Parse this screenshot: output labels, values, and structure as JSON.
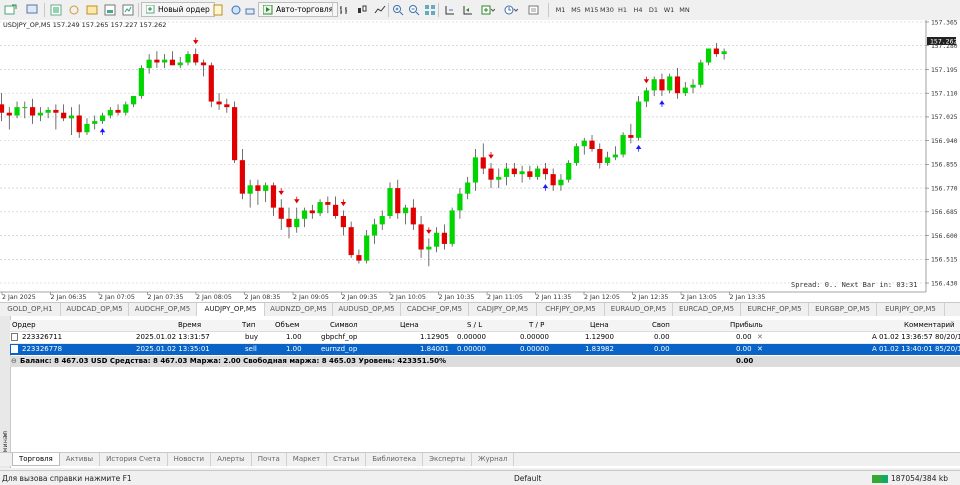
{
  "toolbar": {
    "new_order": "Новый ордер",
    "autotrading": "Авто-торговля",
    "timeframes": [
      "M1",
      "M5",
      "M15",
      "M30",
      "H1",
      "H4",
      "D1",
      "W1",
      "MN"
    ]
  },
  "chart": {
    "header": "USDJPY_OP,M5  157.249 157.265 157.227 157.262",
    "current_price": "157.262",
    "price_labels": [
      "157.365",
      "157.280",
      "157.195",
      "157.110",
      "157.025",
      "156.940",
      "156.855",
      "156.770",
      "156.685",
      "156.600",
      "156.515",
      "156.430"
    ],
    "time_labels": [
      "2 Jan 2025",
      "2 Jan 06:35",
      "2 Jan 07:05",
      "2 Jan 07:35",
      "2 Jan 08:05",
      "2 Jan 08:35",
      "2 Jan 09:05",
      "2 Jan 09:35",
      "2 Jan 10:05",
      "2 Jan 10:35",
      "2 Jan 11:05",
      "2 Jan 11:35",
      "2 Jan 12:05",
      "2 Jan 12:35",
      "2 Jan 13:05",
      "2 Jan 13:35"
    ],
    "spread_text": "Spread: 0.. Next Bar in: 03:31",
    "colors": {
      "bull": "#00d500",
      "bear": "#e00000",
      "arrow_up": "#1a1aff",
      "arrow_down": "#e00000",
      "grid": "#c8c8c8"
    }
  },
  "chart_data": {
    "type": "candlestick",
    "ylim": [
      156.43,
      157.365
    ],
    "candles": [
      [
        157.07,
        157.11,
        157.01,
        157.04
      ],
      [
        157.04,
        157.06,
        156.98,
        157.03
      ],
      [
        157.03,
        157.08,
        157.02,
        157.06
      ],
      [
        157.06,
        157.08,
        157.02,
        157.06
      ],
      [
        157.06,
        157.09,
        157.0,
        157.03
      ],
      [
        157.03,
        157.06,
        157.01,
        157.04
      ],
      [
        157.04,
        157.06,
        157.02,
        157.05
      ],
      [
        157.05,
        157.07,
        156.98,
        157.04
      ],
      [
        157.04,
        157.07,
        157.01,
        157.02
      ],
      [
        157.02,
        157.06,
        156.96,
        157.03
      ],
      [
        157.03,
        157.07,
        156.95,
        156.97
      ],
      [
        156.97,
        157.02,
        156.96,
        157.0
      ],
      [
        157.0,
        157.03,
        156.98,
        157.01
      ],
      [
        157.01,
        157.04,
        157.0,
        157.03
      ],
      [
        157.03,
        157.06,
        157.02,
        157.05
      ],
      [
        157.05,
        157.07,
        157.03,
        157.04
      ],
      [
        157.04,
        157.08,
        157.03,
        157.07
      ],
      [
        157.07,
        157.1,
        157.06,
        157.1
      ],
      [
        157.1,
        157.21,
        157.09,
        157.2
      ],
      [
        157.2,
        157.25,
        157.18,
        157.23
      ],
      [
        157.23,
        157.26,
        157.2,
        157.22
      ],
      [
        157.22,
        157.25,
        157.2,
        157.23
      ],
      [
        157.23,
        157.26,
        157.21,
        157.21
      ],
      [
        157.21,
        157.24,
        157.2,
        157.22
      ],
      [
        157.22,
        157.26,
        157.21,
        157.25
      ],
      [
        157.25,
        157.27,
        157.21,
        157.22
      ],
      [
        157.22,
        157.23,
        157.17,
        157.21
      ],
      [
        157.21,
        157.22,
        157.06,
        157.08
      ],
      [
        157.08,
        157.11,
        157.05,
        157.07
      ],
      [
        157.07,
        157.09,
        157.04,
        157.06
      ],
      [
        157.06,
        157.08,
        156.86,
        156.87
      ],
      [
        156.87,
        156.91,
        156.73,
        156.75
      ],
      [
        156.75,
        156.8,
        156.7,
        156.78
      ],
      [
        156.78,
        156.8,
        156.71,
        156.76
      ],
      [
        156.76,
        156.79,
        156.72,
        156.78
      ],
      [
        156.78,
        156.79,
        156.67,
        156.7
      ],
      [
        156.7,
        156.73,
        156.62,
        156.66
      ],
      [
        156.66,
        156.7,
        156.59,
        156.63
      ],
      [
        156.63,
        156.7,
        156.61,
        156.66
      ],
      [
        156.66,
        156.7,
        156.63,
        156.69
      ],
      [
        156.69,
        156.71,
        156.66,
        156.68
      ],
      [
        156.68,
        156.73,
        156.67,
        156.72
      ],
      [
        156.72,
        156.74,
        156.68,
        156.71
      ],
      [
        156.71,
        156.74,
        156.66,
        156.67
      ],
      [
        156.67,
        156.69,
        156.6,
        156.63
      ],
      [
        156.63,
        156.65,
        156.52,
        156.53
      ],
      [
        156.53,
        156.55,
        156.5,
        156.51
      ],
      [
        156.51,
        156.62,
        156.5,
        156.6
      ],
      [
        156.6,
        156.66,
        156.57,
        156.64
      ],
      [
        156.64,
        156.69,
        156.62,
        156.67
      ],
      [
        156.67,
        156.79,
        156.66,
        156.77
      ],
      [
        156.77,
        156.8,
        156.66,
        156.68
      ],
      [
        156.68,
        156.71,
        156.64,
        156.7
      ],
      [
        156.7,
        156.73,
        156.62,
        156.64
      ],
      [
        156.64,
        156.67,
        156.52,
        156.55
      ],
      [
        156.55,
        156.59,
        156.49,
        156.56
      ],
      [
        156.56,
        156.63,
        156.54,
        156.61
      ],
      [
        156.61,
        156.64,
        156.55,
        156.57
      ],
      [
        156.57,
        156.7,
        156.56,
        156.69
      ],
      [
        156.69,
        156.77,
        156.66,
        156.75
      ],
      [
        156.75,
        156.81,
        156.73,
        156.79
      ],
      [
        156.79,
        156.91,
        156.76,
        156.88
      ],
      [
        156.88,
        156.93,
        156.82,
        156.84
      ],
      [
        156.84,
        156.86,
        156.77,
        156.8
      ],
      [
        156.8,
        156.84,
        156.77,
        156.81
      ],
      [
        156.81,
        156.86,
        156.78,
        156.84
      ],
      [
        156.84,
        156.86,
        156.81,
        156.82
      ],
      [
        156.82,
        156.85,
        156.79,
        156.83
      ],
      [
        156.83,
        156.85,
        156.8,
        156.81
      ],
      [
        156.81,
        156.85,
        156.8,
        156.84
      ],
      [
        156.84,
        156.86,
        156.8,
        156.82
      ],
      [
        156.82,
        156.84,
        156.76,
        156.78
      ],
      [
        156.78,
        156.82,
        156.76,
        156.8
      ],
      [
        156.8,
        156.87,
        156.79,
        156.86
      ],
      [
        156.86,
        156.93,
        156.85,
        156.92
      ],
      [
        156.92,
        156.95,
        156.89,
        156.94
      ],
      [
        156.94,
        156.96,
        156.9,
        156.91
      ],
      [
        156.91,
        156.93,
        156.84,
        156.86
      ],
      [
        156.86,
        156.9,
        156.85,
        156.88
      ],
      [
        156.88,
        156.92,
        156.87,
        156.89
      ],
      [
        156.89,
        156.97,
        156.88,
        156.96
      ],
      [
        156.96,
        157.0,
        156.93,
        156.95
      ],
      [
        156.95,
        157.1,
        156.94,
        157.08
      ],
      [
        157.08,
        157.13,
        157.06,
        157.12
      ],
      [
        157.12,
        157.17,
        157.1,
        157.16
      ],
      [
        157.16,
        157.18,
        157.1,
        157.12
      ],
      [
        157.12,
        157.18,
        157.11,
        157.17
      ],
      [
        157.17,
        157.2,
        157.09,
        157.11
      ],
      [
        157.11,
        157.15,
        157.1,
        157.13
      ],
      [
        157.13,
        157.16,
        157.11,
        157.14
      ],
      [
        157.14,
        157.23,
        157.13,
        157.22
      ],
      [
        157.22,
        157.27,
        157.21,
        157.27
      ],
      [
        157.27,
        157.29,
        157.24,
        157.25
      ],
      [
        157.25,
        157.27,
        157.23,
        157.26
      ]
    ],
    "signals_down": [
      25,
      36,
      38,
      44,
      55,
      63,
      83
    ],
    "signals_up": [
      13,
      70,
      82,
      85
    ]
  },
  "symbol_tabs": [
    "GOLD_OP,H1",
    "AUDCAD_OP,M5",
    "AUDCHF_OP,M5",
    "AUDJPY_OP,M5",
    "AUDNZD_OP,M5",
    "AUDUSD_OP,M5",
    "CADCHF_OP,M5",
    "CADJPY_OP,M5",
    "CHFJPY_OP,M5",
    "EURAUD_OP,M5",
    "EURCAD_OP,M5",
    "EURCHF_OP,M5",
    "EURGBP_OP,M5",
    "EURJPY_OP,M5",
    "EUI"
  ],
  "terminal": {
    "side_label": "Терминал",
    "close": "×",
    "headers": {
      "order": "Ордер",
      "time": "Время",
      "type": "Тип",
      "volume": "Объем",
      "symbol": "Символ",
      "price": "Цена",
      "sl": "S / L",
      "tp": "T / P",
      "price2": "Цена",
      "swap": "Своп",
      "profit": "Прибыль",
      "comment": "Комментарий"
    },
    "rows": [
      {
        "order": "223326711",
        "time": "2025.01.02 13:31:57",
        "type": "buy",
        "volume": "1.00",
        "symbol": "gbpchf_op",
        "price": "1.12905",
        "sl": "0.00000",
        "tp": "0.00000",
        "price2": "1.12900",
        "swap": "0.00",
        "profit": "0.00",
        "comment": "A 01.02 13:36:57 80/20/10"
      },
      {
        "order": "223326778",
        "time": "2025.01.02 13:35:01",
        "type": "sell",
        "volume": "1.00",
        "symbol": "eurnzd_op",
        "price": "1.84001",
        "sl": "0.00000",
        "tp": "0.00000",
        "price2": "1.83982",
        "swap": "0.00",
        "profit": "0.00",
        "comment": "A 01.02 13:40:01 85/20/10"
      }
    ],
    "balance": "Баланс: 8 467.03 USD  Средства: 8 467.03  Маржа: 2.00  Свободная маржа: 8 465.03  Уровень: 423351.50%",
    "balance_profit": "0.00"
  },
  "bottom_tabs": [
    "Торговля",
    "Активы",
    "История Счета",
    "Новости",
    "Алерты",
    "Почта",
    "Маркет",
    "Статьи",
    "Библиотека",
    "Эксперты",
    "Журнал"
  ],
  "status": {
    "help": "Для вызова справки нажмите F1",
    "profile": "Default",
    "traffic": "187054/384 kb"
  }
}
